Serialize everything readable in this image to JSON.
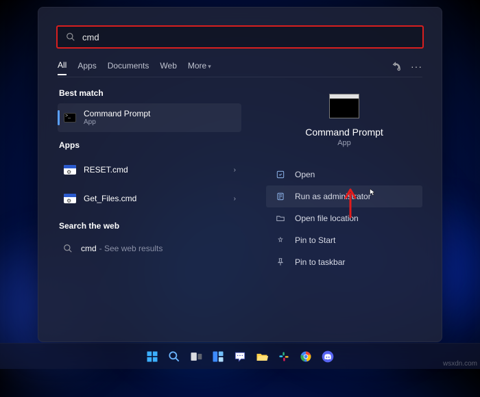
{
  "search": {
    "query": "cmd"
  },
  "filters": {
    "items": [
      "All",
      "Apps",
      "Documents",
      "Web",
      "More"
    ],
    "active": 0
  },
  "best_match": {
    "label": "Best match",
    "item": {
      "title": "Command Prompt",
      "subtitle": "App"
    }
  },
  "apps_section": {
    "label": "Apps",
    "items": [
      {
        "title": "RESET.cmd"
      },
      {
        "title": "Get_Files.cmd"
      }
    ]
  },
  "web_section": {
    "label": "Search the web",
    "query": "cmd",
    "hint": "- See web results"
  },
  "preview": {
    "title": "Command Prompt",
    "subtitle": "App",
    "actions": [
      {
        "id": "open",
        "label": "Open"
      },
      {
        "id": "runadmin",
        "label": "Run as administrator"
      },
      {
        "id": "openloc",
        "label": "Open file location"
      },
      {
        "id": "pinstart",
        "label": "Pin to Start"
      },
      {
        "id": "pintask",
        "label": "Pin to taskbar"
      }
    ]
  },
  "watermark": "wsxdn.com"
}
